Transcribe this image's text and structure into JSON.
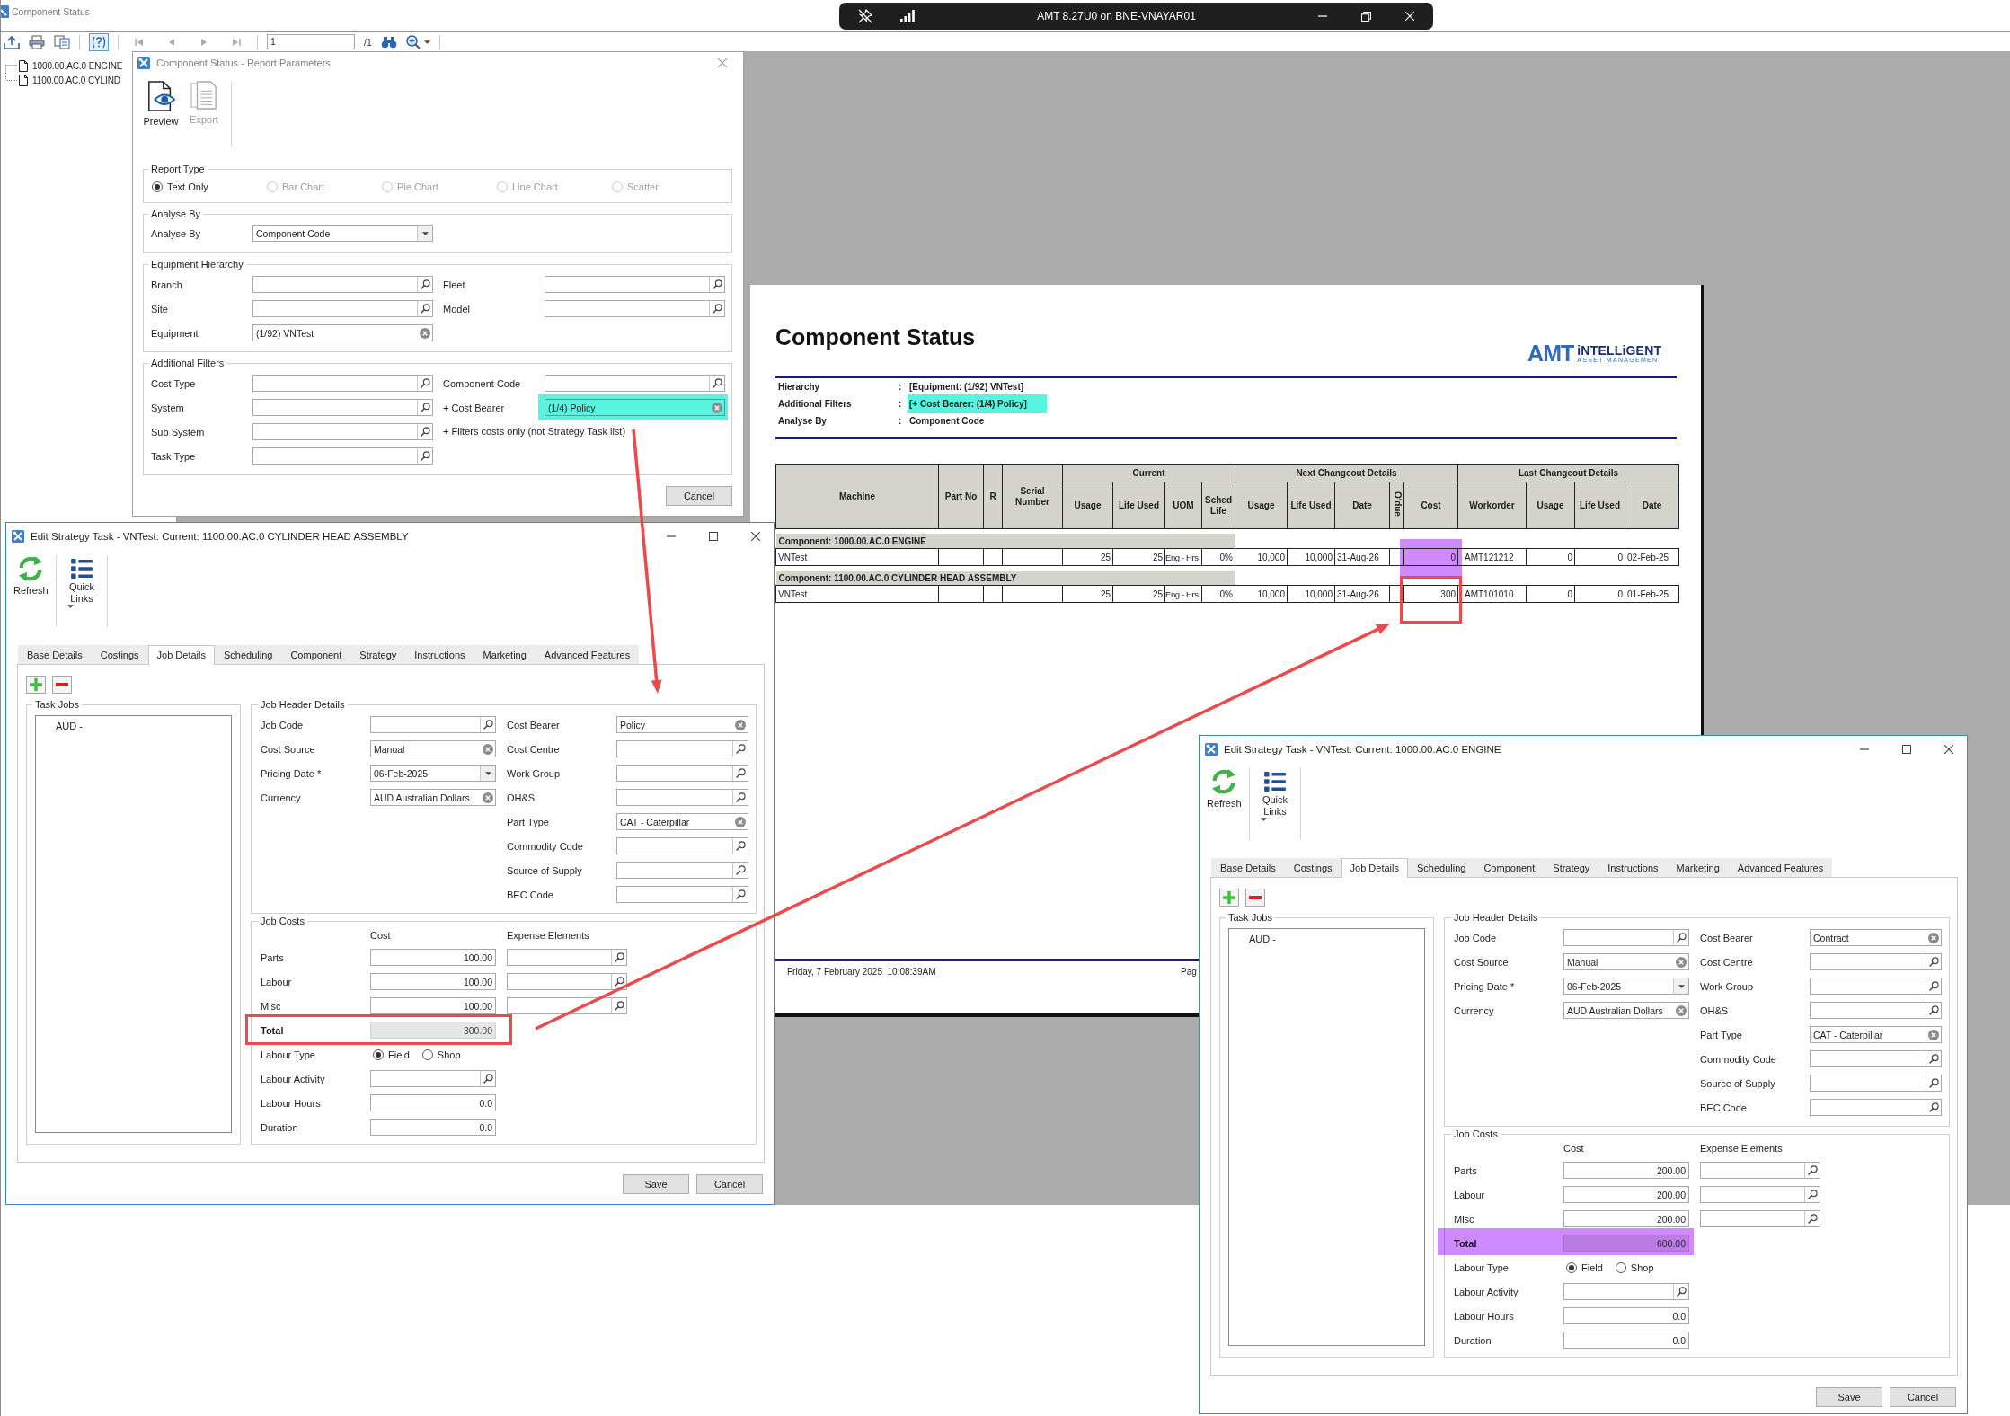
{
  "app_window": {
    "title": "Component Status",
    "toolbar": {
      "page_field": "1",
      "page_count": "/1"
    },
    "tree": [
      {
        "label": "1000.00.AC.0 ENGINE"
      },
      {
        "label": "1100.00.AC.0 CYLIND"
      }
    ]
  },
  "remote_session_bar": {
    "title": "AMT 8.27U0 on BNE-VNAYAR01"
  },
  "report_parameters": {
    "title": "Component Status - Report Parameters",
    "toolbar": [
      {
        "label": "Preview",
        "kind": "preview",
        "disabled": false
      },
      {
        "label": "Export",
        "kind": "export",
        "disabled": true
      }
    ],
    "report_type": {
      "legend": "Report Type",
      "options": [
        {
          "label": "Text Only",
          "selected": true,
          "disabled": false
        },
        {
          "label": "Bar Chart",
          "selected": false,
          "disabled": true
        },
        {
          "label": "Pie Chart",
          "selected": false,
          "disabled": true
        },
        {
          "label": "Line Chart",
          "selected": false,
          "disabled": true
        },
        {
          "label": "Scatter",
          "selected": false,
          "disabled": true
        }
      ]
    },
    "analyse_by": {
      "legend": "Analyse By",
      "left": [
        {
          "label": "Analyse By",
          "kind": "dropdown",
          "value": "Component Code"
        }
      ]
    },
    "equipment_hierarchy": {
      "legend": "Equipment Hierarchy",
      "left": [
        {
          "label": "Branch",
          "kind": "lookup"
        },
        {
          "label": "Site",
          "kind": "lookup"
        },
        {
          "label": "Equipment",
          "kind": "clear",
          "value": "(1/92) VNTest"
        }
      ],
      "right": [
        {
          "label": "Fleet",
          "kind": "lookup"
        },
        {
          "label": "Model",
          "kind": "lookup"
        }
      ]
    },
    "additional_filters": {
      "legend": "Additional Filters",
      "left": [
        {
          "label": "Cost Type",
          "kind": "lookup"
        },
        {
          "label": "System",
          "kind": "lookup"
        },
        {
          "label": "Sub System",
          "kind": "lookup"
        },
        {
          "label": "Task Type",
          "kind": "lookup"
        }
      ],
      "right": [
        {
          "label": "Component Code",
          "kind": "lookup"
        },
        {
          "label": "+ Cost Bearer",
          "kind": "clear",
          "value": "(1/4) Policy",
          "color": "#55f5df"
        }
      ],
      "note": "+ Filters costs only (not Strategy Task list)"
    },
    "buttons": [
      {
        "label": "Cancel"
      }
    ]
  },
  "report_page": {
    "title": "Component Status",
    "logo": {
      "mark": "AMT",
      "line_1": "iNTELLiGENT",
      "line_2": "ASSET MANAGEMENT"
    },
    "criteria": [
      {
        "label": "Hierarchy",
        "separator": ":",
        "value": "[Equipment: (1/92) VNTest]"
      },
      {
        "label": "Additional Filters",
        "separator": ":",
        "value": "[+ Cost Bearer: (1/4) Policy]"
      },
      {
        "label": "Analyse By",
        "separator": ":",
        "value": "Component Code"
      }
    ],
    "table": {
      "header": [
        {
          "label": "Machine"
        },
        {
          "label": "Part No"
        },
        {
          "label": "R"
        },
        {
          "label": "Serial Number"
        },
        {
          "label": "Current",
          "columns": [
            {
              "label": "Usage",
              "rotated": false
            },
            {
              "label": "Life Used",
              "rotated": false
            },
            {
              "label": "UOM",
              "rotated": false
            },
            {
              "label": "Sched Life",
              "rotated": false
            }
          ]
        },
        {
          "label": "Next Changeout Details",
          "columns": [
            {
              "label": "Usage",
              "rotated": false
            },
            {
              "label": "Life Used",
              "rotated": false
            },
            {
              "label": "Date",
              "rotated": false
            },
            {
              "label": "O'due",
              "rotated": true
            },
            {
              "label": "Cost",
              "rotated": false
            }
          ]
        },
        {
          "label": "Last Changeout Details",
          "columns": [
            {
              "label": "Workorder",
              "rotated": false
            },
            {
              "label": "Usage",
              "rotated": false
            },
            {
              "label": "Life Used",
              "rotated": false
            },
            {
              "label": "Date",
              "rotated": false
            }
          ]
        }
      ],
      "groups": [
        {
          "title": "Component: 1000.00.AC.0 ENGINE",
          "rows": [
            [
              "VNTest",
              null,
              null,
              null,
              "25",
              "25",
              "Eng - Hrs",
              "0%",
              "10,000",
              "10,000",
              "31-Aug-26",
              null,
              "0",
              "AMT121212",
              "0",
              "0",
              "02-Feb-25"
            ]
          ]
        },
        {
          "title": "Component: 1100.00.AC.0 CYLINDER HEAD ASSEMBLY",
          "rows": [
            [
              "VNTest",
              null,
              null,
              null,
              "25",
              "25",
              "Eng - Hrs",
              "0%",
              "10,000",
              "10,000",
              "31-Aug-26",
              null,
              "300",
              "AMT101010",
              "0",
              "0",
              "01-Feb-25"
            ]
          ]
        }
      ]
    },
    "footer": {
      "printed_at": "Friday, 7 February 2025  10:08:39AM",
      "page_label": "Pag"
    }
  },
  "edit_dialogs": [
    {
      "title": "Edit Strategy Task - VNTest: Current: 1100.00.AC.0 CYLINDER HEAD ASSEMBLY",
      "toolbar": [
        {
          "label": "Refresh",
          "kind": "refresh"
        },
        {
          "label": "Quick Links",
          "kind": "quick_links"
        }
      ],
      "tabs": [
        {
          "label": "Base Details",
          "selected": false
        },
        {
          "label": "Costings",
          "selected": false
        },
        {
          "label": "Job Details",
          "selected": true
        },
        {
          "label": "Scheduling",
          "selected": false
        },
        {
          "label": "Component",
          "selected": false
        },
        {
          "label": "Strategy",
          "selected": false
        },
        {
          "label": "Instructions",
          "selected": false
        },
        {
          "label": "Marketing",
          "selected": false
        },
        {
          "label": "Advanced Features",
          "selected": false
        }
      ],
      "task_jobs": {
        "legend": "Task Jobs",
        "items": [
          {
            "label": "AUD -"
          }
        ]
      },
      "job_header": {
        "legend": "Job Header Details",
        "left": [
          {
            "label": "Job Code",
            "kind": "lookup"
          },
          {
            "label": "Cost Source",
            "kind": "clear",
            "value": "Manual"
          },
          {
            "label": "Pricing Date *",
            "kind": "dropdown",
            "value": "06-Feb-2025"
          },
          {
            "label": "Currency",
            "kind": "clear",
            "value": "AUD Australian Dollars"
          }
        ],
        "right": [
          {
            "label": "Cost Bearer",
            "kind": "clear",
            "value": "Policy"
          },
          {
            "label": "Cost Centre",
            "kind": "lookup"
          },
          {
            "label": "Work Group",
            "kind": "lookup"
          },
          {
            "label": "OH&S",
            "kind": "lookup"
          },
          {
            "label": "Part Type",
            "kind": "clear",
            "value": "CAT - Caterpillar"
          },
          {
            "label": "Commodity Code",
            "kind": "lookup"
          },
          {
            "label": "Source of Supply",
            "kind": "lookup"
          },
          {
            "label": "BEC Code",
            "kind": "lookup"
          }
        ]
      },
      "job_costs": {
        "legend": "Job Costs",
        "cost_heading": "Cost",
        "expense_heading": "Expense Elements",
        "rows": [
          {
            "label": "Parts",
            "kind": "line",
            "cost": {
              "kind": "amount",
              "value": "100.00",
              "disabled": false
            },
            "expense": {
              "kind": "lookup"
            }
          },
          {
            "label": "Labour",
            "kind": "line",
            "cost": {
              "kind": "amount",
              "value": "100.00",
              "disabled": false
            },
            "expense": {
              "kind": "lookup"
            }
          },
          {
            "label": "Misc",
            "kind": "line",
            "cost": {
              "kind": "amount",
              "value": "100.00",
              "disabled": false
            },
            "expense": {
              "kind": "lookup"
            }
          },
          {
            "label": "Total",
            "kind": "total",
            "cost": {
              "kind": "amount",
              "value": "300.00",
              "disabled": true
            }
          }
        ],
        "labour_type": {
          "label": "Labour Type",
          "options": [
            {
              "label": "Field",
              "selected": true
            },
            {
              "label": "Shop",
              "selected": false
            }
          ]
        },
        "other_fields": [
          {
            "label": "Labour Activity",
            "kind": "lookup"
          },
          {
            "label": "Labour Hours",
            "kind": "amount",
            "value": "0.0"
          },
          {
            "label": "Duration",
            "kind": "amount",
            "value": "0.0"
          }
        ]
      },
      "buttons": [
        {
          "label": "Save"
        },
        {
          "label": "Cancel"
        }
      ]
    },
    {
      "title": "Edit Strategy Task - VNTest: Current: 1000.00.AC.0 ENGINE",
      "toolbar": [
        {
          "label": "Refresh",
          "kind": "refresh"
        },
        {
          "label": "Quick Links",
          "kind": "quick_links"
        }
      ],
      "tabs": [
        {
          "label": "Base Details",
          "selected": false
        },
        {
          "label": "Costings",
          "selected": false
        },
        {
          "label": "Job Details",
          "selected": true
        },
        {
          "label": "Scheduling",
          "selected": false
        },
        {
          "label": "Component",
          "selected": false
        },
        {
          "label": "Strategy",
          "selected": false
        },
        {
          "label": "Instructions",
          "selected": false
        },
        {
          "label": "Marketing",
          "selected": false
        },
        {
          "label": "Advanced Features",
          "selected": false
        }
      ],
      "task_jobs": {
        "legend": "Task Jobs",
        "items": [
          {
            "label": "AUD -"
          }
        ]
      },
      "job_header": {
        "legend": "Job Header Details",
        "left": [
          {
            "label": "Job Code",
            "kind": "lookup"
          },
          {
            "label": "Cost Source",
            "kind": "clear",
            "value": "Manual"
          },
          {
            "label": "Pricing Date *",
            "kind": "dropdown",
            "value": "06-Feb-2025"
          },
          {
            "label": "Currency",
            "kind": "clear",
            "value": "AUD Australian Dollars"
          }
        ],
        "right": [
          {
            "label": "Cost Bearer",
            "kind": "clear",
            "value": "Contract"
          },
          {
            "label": "Cost Centre",
            "kind": "lookup"
          },
          {
            "label": "Work Group",
            "kind": "lookup"
          },
          {
            "label": "OH&S",
            "kind": "lookup"
          },
          {
            "label": "Part Type",
            "kind": "clear",
            "value": "CAT - Caterpillar"
          },
          {
            "label": "Commodity Code",
            "kind": "lookup"
          },
          {
            "label": "Source of Supply",
            "kind": "lookup"
          },
          {
            "label": "BEC Code",
            "kind": "lookup"
          }
        ]
      },
      "job_costs": {
        "legend": "Job Costs",
        "cost_heading": "Cost",
        "expense_heading": "Expense Elements",
        "rows": [
          {
            "label": "Parts",
            "kind": "line",
            "cost": {
              "kind": "amount",
              "value": "200.00",
              "disabled": false
            },
            "expense": {
              "kind": "lookup"
            }
          },
          {
            "label": "Labour",
            "kind": "line",
            "cost": {
              "kind": "amount",
              "value": "200.00",
              "disabled": false
            },
            "expense": {
              "kind": "lookup"
            }
          },
          {
            "label": "Misc",
            "kind": "line",
            "cost": {
              "kind": "amount",
              "value": "200.00",
              "disabled": false
            },
            "expense": {
              "kind": "lookup"
            }
          },
          {
            "label": "Total",
            "kind": "total",
            "cost": {
              "kind": "amount",
              "value": "600.00",
              "disabled": true
            }
          }
        ],
        "labour_type": {
          "label": "Labour Type",
          "options": [
            {
              "label": "Field",
              "selected": true
            },
            {
              "label": "Shop",
              "selected": false
            }
          ]
        },
        "other_fields": [
          {
            "label": "Labour Activity",
            "kind": "lookup"
          },
          {
            "label": "Labour Hours",
            "kind": "amount",
            "value": "0.0"
          },
          {
            "label": "Duration",
            "kind": "amount",
            "value": "0.0"
          }
        ]
      },
      "buttons": [
        {
          "label": "Save"
        },
        {
          "label": "Cancel"
        }
      ]
    }
  ],
  "annotations": [
    {
      "kind": "highlight",
      "color": "#55f5df"
    },
    {
      "kind": "highlight",
      "color": "#d08aff"
    },
    {
      "kind": "frame",
      "color": "#ec4a4a"
    },
    {
      "kind": "frame",
      "color": "#ec4a4a"
    },
    {
      "kind": "highlight",
      "color": "#d08aff"
    },
    {
      "kind": "arrow",
      "color": "#ec4a4a"
    },
    {
      "kind": "arrow",
      "color": "#ec4a4a"
    }
  ]
}
